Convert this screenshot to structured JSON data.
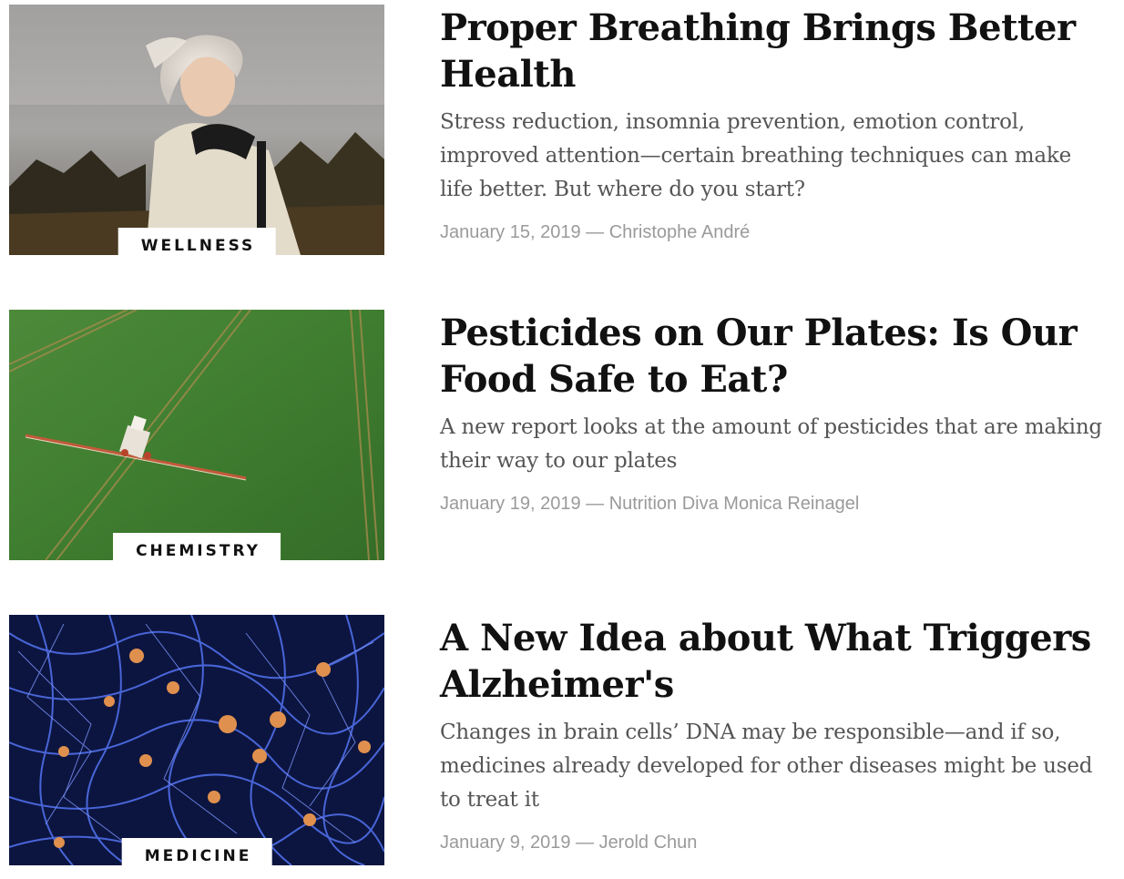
{
  "articles": [
    {
      "category": "WELLNESS",
      "title": "Proper Breathing Brings Better Health",
      "dek": "Stress reduction, insomnia prevention, emotion control, improved attention—certain breathing techniques can make life better. But where do you start?",
      "date": "January 15, 2019",
      "separator": "—",
      "author": "Christophe André"
    },
    {
      "category": "CHEMISTRY",
      "title": "Pesticides on Our Plates: Is Our Food Safe to Eat?",
      "dek": "A new report looks at the amount of pesticides that are making their way to our plates",
      "date": "January 19, 2019",
      "separator": "—",
      "author": "Nutrition Diva Monica Reinagel"
    },
    {
      "category": "MEDICINE",
      "title": "A New Idea about What Triggers Alzheimer's",
      "dek": "Changes in brain cells’ DNA may be responsible—and if so, medicines already developed for other diseases might be used to treat it",
      "date": "January 9, 2019",
      "separator": "—",
      "author": "Jerold Chun"
    }
  ]
}
